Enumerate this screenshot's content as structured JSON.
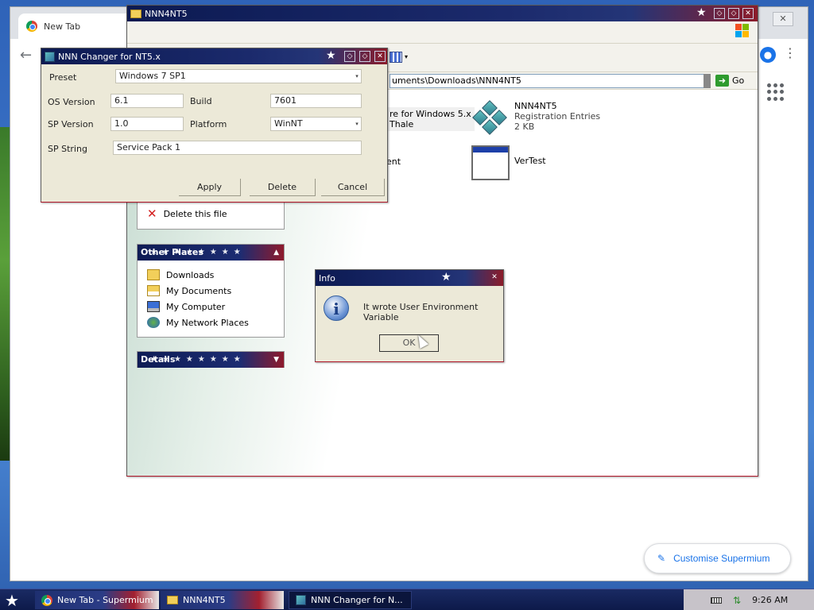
{
  "browser": {
    "tab_title": "New Tab",
    "close_symbol": "✕",
    "customise_label": "Customise Supermium"
  },
  "explorer": {
    "title": "NNN4NT5",
    "address": "C:\\Documents and Settings\\User\\My Documents\\Downloads\\NNN4NT5",
    "address_visible": "uments\\Downloads\\NNN4NT5",
    "go_label": "Go",
    "partial_item_line1": "re for Windows 5.x",
    "partial_item_line2": "Thale",
    "partial_item_2": "ent",
    "files": [
      {
        "name": "NNN4NT5",
        "type": "Registration Entries",
        "size": "2 KB",
        "icon": "registry-icon"
      },
      {
        "name": "VerTest",
        "type": "",
        "size": "",
        "icon": "application-window-icon"
      }
    ],
    "file_task": {
      "label": "Delete this file",
      "icon": "delete-x-icon"
    },
    "other_places": {
      "header": "Other Places",
      "items": [
        {
          "label": "Downloads",
          "icon": "folder-icon"
        },
        {
          "label": "My Documents",
          "icon": "my-documents-icon"
        },
        {
          "label": "My Computer",
          "icon": "my-computer-icon"
        },
        {
          "label": "My Network Places",
          "icon": "network-places-icon"
        }
      ]
    },
    "details": {
      "header": "Details"
    }
  },
  "changer": {
    "title": "NNN Changer for NT5.x",
    "preset_label": "Preset",
    "preset_value": "Windows 7 SP1",
    "os_version_label": "OS Version",
    "os_version_value": "6.1",
    "build_label": "Build",
    "build_value": "7601",
    "sp_version_label": "SP Version",
    "sp_version_value": "1.0",
    "platform_label": "Platform",
    "platform_value": "WinNT",
    "sp_string_label": "SP String",
    "sp_string_value": "Service Pack 1",
    "apply_label": "Apply",
    "delete_label": "Delete",
    "cancel_label": "Cancel"
  },
  "info_dialog": {
    "title": "Info",
    "message": "It wrote User Environment Variable",
    "ok_label": "OK"
  },
  "taskbar": {
    "items": [
      {
        "label": "New Tab - Supermium",
        "icon": "chromium-icon"
      },
      {
        "label": "NNN4NT5",
        "icon": "folder-icon"
      },
      {
        "label": "NNN Changer for N...",
        "icon": "app-icon"
      }
    ],
    "clock": "9:26 AM"
  },
  "colors": {
    "title_blue": "#0c1a52",
    "title_red": "#8c1c2a",
    "window_face": "#ece9d8",
    "link_blue": "#1a73e8"
  }
}
